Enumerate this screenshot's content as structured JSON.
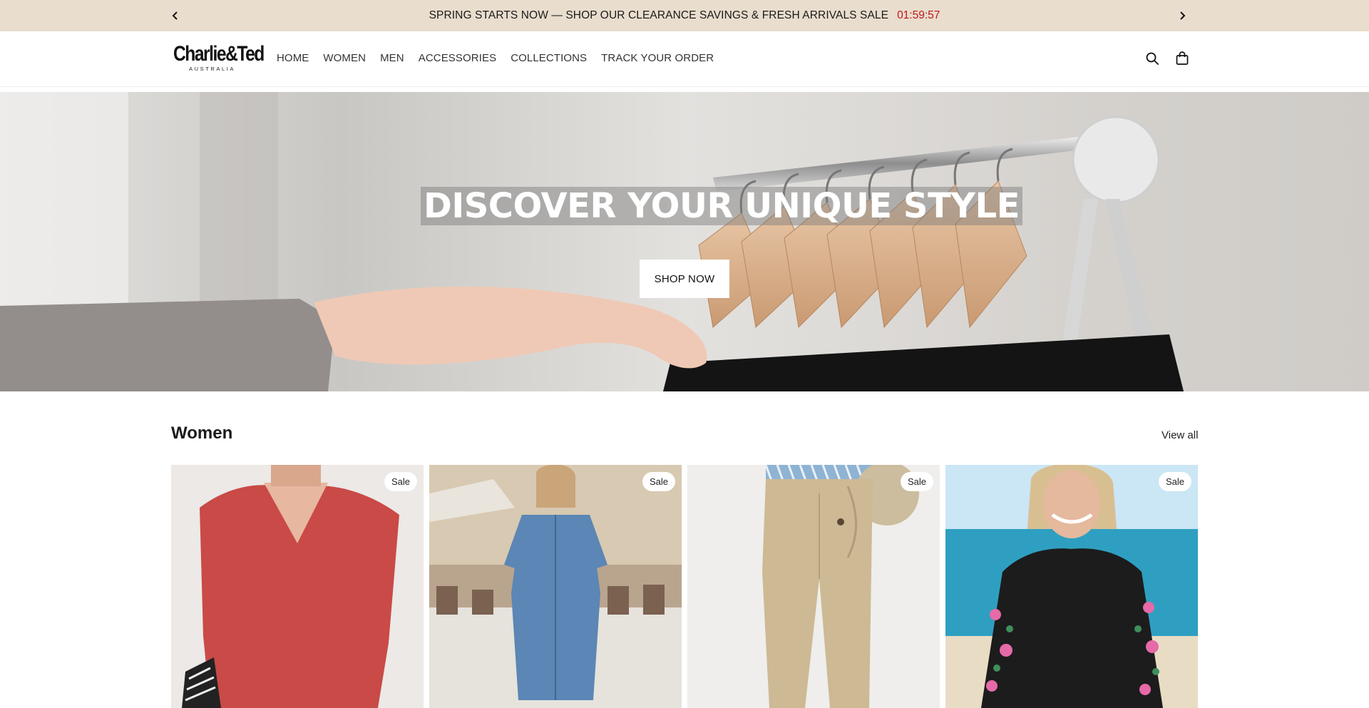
{
  "announcement": {
    "message": "SPRING STARTS NOW — SHOP OUR CLEARANCE SAVINGS & FRESH ARRIVALS SALE",
    "countdown": "01:59:57",
    "prev_icon": "chevron-left-icon",
    "next_icon": "chevron-right-icon",
    "countdown_color": "#c0161c",
    "background": "#e9ddcd"
  },
  "header": {
    "logo_text": "Charlie&Ted",
    "logo_subtext": "AUSTRALIA",
    "nav": [
      "HOME",
      "WOMEN",
      "MEN",
      "ACCESSORIES",
      "COLLECTIONS",
      "TRACK YOUR ORDER"
    ],
    "icons": [
      "search-icon",
      "bag-icon"
    ]
  },
  "hero": {
    "title": "DISCOVER YOUR UNIQUE STYLE",
    "button": "SHOP NOW"
  },
  "collection": {
    "title": "Women",
    "view_all": "View all",
    "products": [
      {
        "badge": "Sale",
        "image": "red knit v-neck top"
      },
      {
        "badge": "Sale",
        "image": "blue denim shirt dress"
      },
      {
        "badge": "Sale",
        "image": "beige linen pants"
      },
      {
        "badge": "Sale",
        "image": "black floral long-sleeve swim top"
      }
    ]
  }
}
